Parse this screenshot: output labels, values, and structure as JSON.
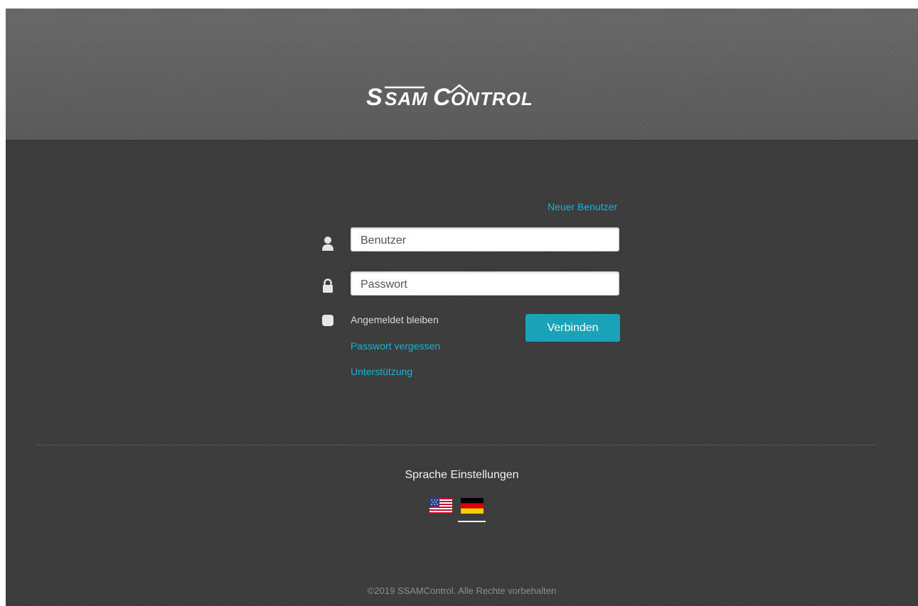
{
  "brand": {
    "logo_text": "SSAM CONTROL"
  },
  "login": {
    "new_user_link": "Neuer Benutzer",
    "username_placeholder": "Benutzer",
    "password_placeholder": "Passwort",
    "remember_label": "Angemeldet bleiben",
    "connect_button": "Verbinden",
    "forgot_password_link": "Passwort vergessen",
    "support_link": "Unterstützung",
    "icons": {
      "username": "user-icon",
      "password": "lock-icon"
    }
  },
  "language": {
    "title": "Sprache Einstellungen",
    "options": [
      {
        "code": "en-US",
        "icon": "us-flag-icon",
        "selected": false
      },
      {
        "code": "de",
        "icon": "german-flag-icon",
        "selected": true
      }
    ]
  },
  "footer": {
    "copyright": "©2019 SSAMControl. Alle Rechte vorbehalten"
  },
  "colors": {
    "accent": "#1aa3b8",
    "link": "#16b4d4",
    "background": "#3c3c3c",
    "header": "#5f5f5f"
  }
}
